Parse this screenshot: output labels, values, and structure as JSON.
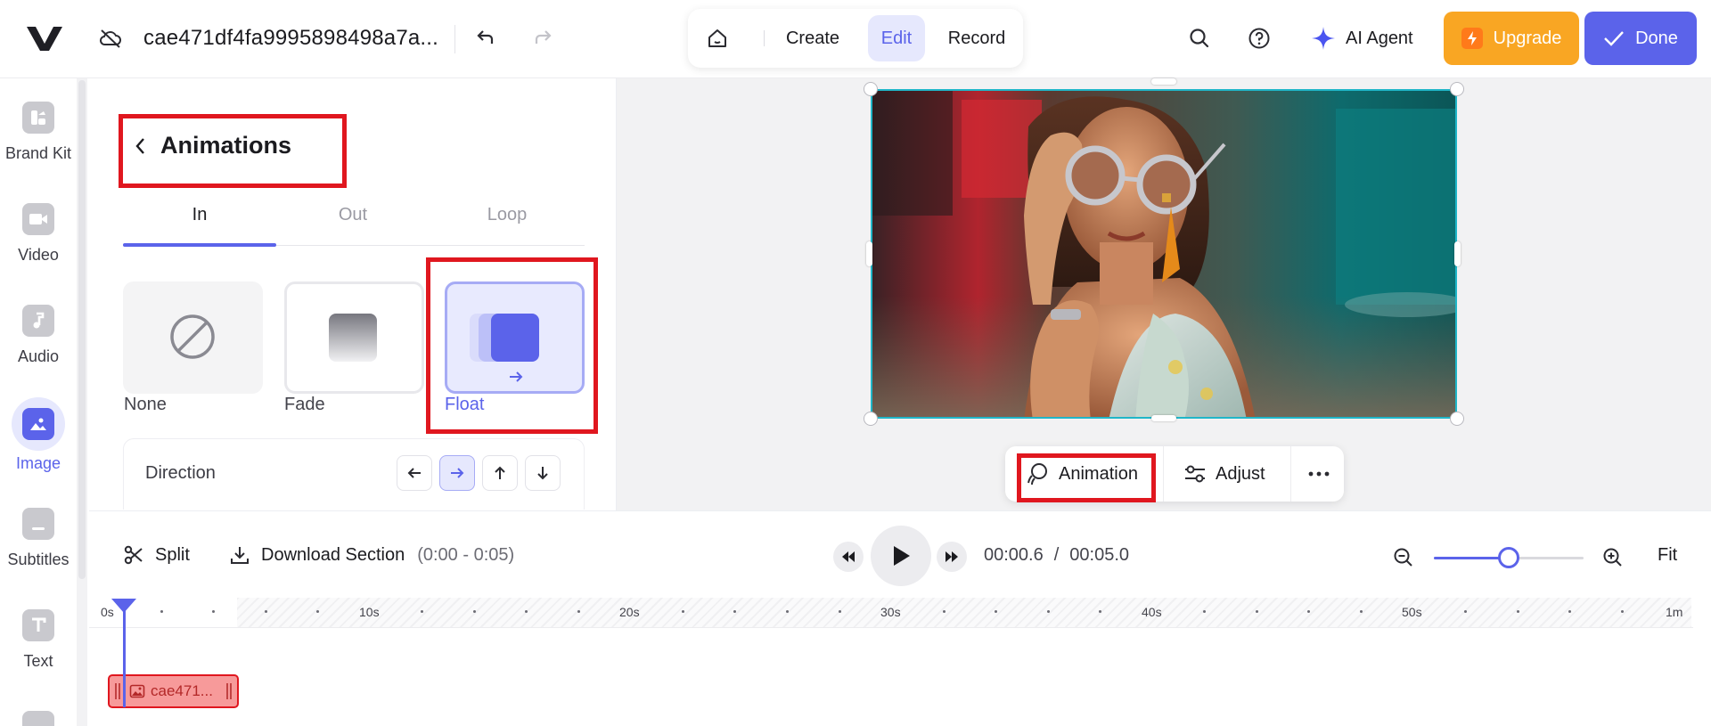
{
  "topbar": {
    "file_name": "cae471df4fa9995898498a7a...",
    "modes": [
      "Create",
      "Edit",
      "Record"
    ],
    "active_mode": "Edit",
    "ai_agent_label": "AI Agent",
    "upgrade_label": "Upgrade",
    "done_label": "Done"
  },
  "rail": {
    "items": [
      {
        "label": "Brand Kit",
        "icon": "brand-kit-icon"
      },
      {
        "label": "Video",
        "icon": "video-icon"
      },
      {
        "label": "Audio",
        "icon": "music-note-icon"
      },
      {
        "label": "Image",
        "icon": "image-icon",
        "active": true
      },
      {
        "label": "Subtitles",
        "icon": "subtitles-icon"
      },
      {
        "label": "Text",
        "icon": "text-icon"
      }
    ]
  },
  "panel": {
    "title": "Animations",
    "tabs": [
      "In",
      "Out",
      "Loop"
    ],
    "active_tab": "In",
    "presets": [
      "None",
      "Fade",
      "Float"
    ],
    "selected_preset": "Float",
    "direction_label": "Direction",
    "directions": [
      "left",
      "right",
      "up",
      "down"
    ],
    "selected_direction": "right"
  },
  "context_menu": {
    "animation_label": "Animation",
    "adjust_label": "Adjust"
  },
  "timeline": {
    "split_label": "Split",
    "download_label": "Download Section",
    "download_range": "(0:00 - 0:05)",
    "current_time": "00:00.6",
    "time_separator": "/",
    "total_time": "00:05.0",
    "fit_label": "Fit",
    "zoom_level": 0.5,
    "ruler_labels": [
      "0s",
      "10s",
      "20s",
      "30s",
      "40s",
      "50s",
      "1m"
    ],
    "clip_label": "cae471..."
  },
  "colors": {
    "accent": "#5b63ea",
    "upgrade": "#f9a623",
    "highlight": "#e0171f",
    "selection": "#20b6c8"
  }
}
